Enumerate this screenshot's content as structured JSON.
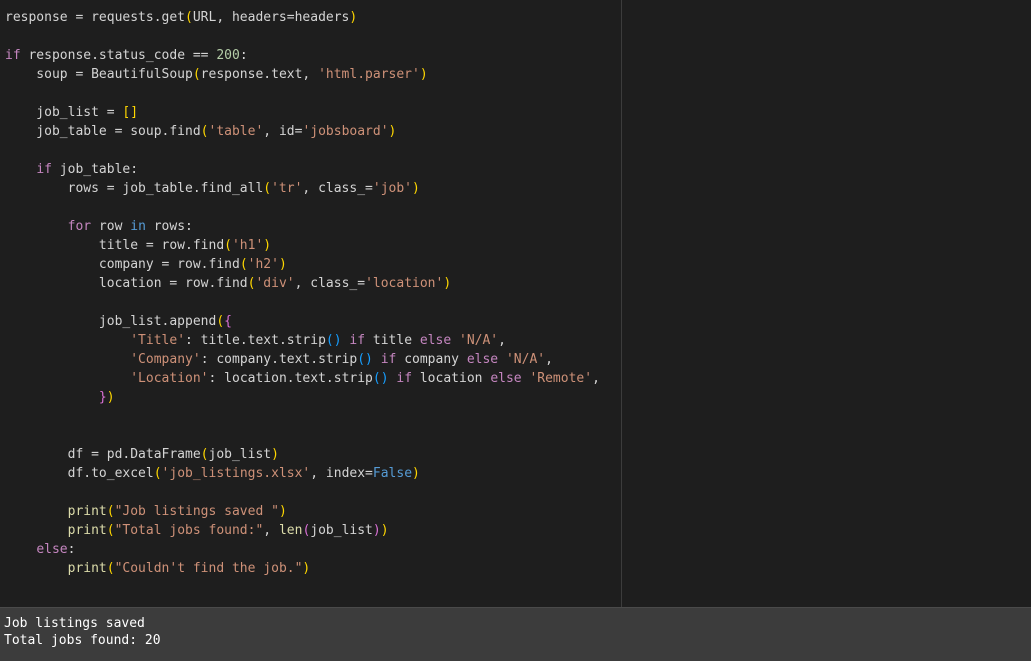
{
  "theme": {
    "default": "#d4d4d4",
    "keyword": "#569cd6",
    "control": "#c586c0",
    "string": "#ce9178",
    "paren": "#ffd700",
    "paren2": "#da70d6",
    "paren3": "#179fff",
    "function": "#dcdcaa",
    "number": "#b5cea8",
    "variable": "#9cdcfe"
  },
  "editor": {
    "lines": [
      [
        [
          "response = requests.get",
          "default"
        ],
        [
          "(",
          "paren"
        ],
        [
          "URL, headers=headers",
          "default"
        ],
        [
          ")",
          "paren"
        ]
      ],
      [],
      [
        [
          "if",
          "control"
        ],
        [
          " response.status_code == ",
          "default"
        ],
        [
          "200",
          "number"
        ],
        [
          ":",
          "default"
        ]
      ],
      [
        [
          "    soup = BeautifulSoup",
          "default"
        ],
        [
          "(",
          "paren"
        ],
        [
          "response.text, ",
          "default"
        ],
        [
          "'html.parser'",
          "string"
        ],
        [
          ")",
          "paren"
        ]
      ],
      [],
      [
        [
          "    job_list = ",
          "default"
        ],
        [
          "[]",
          "paren"
        ]
      ],
      [
        [
          "    job_table = soup.find",
          "default"
        ],
        [
          "(",
          "paren"
        ],
        [
          "'table'",
          "string"
        ],
        [
          ", id=",
          "default"
        ],
        [
          "'jobsboard'",
          "string"
        ],
        [
          ")",
          "paren"
        ]
      ],
      [],
      [
        [
          "    ",
          "default"
        ],
        [
          "if",
          "control"
        ],
        [
          " job_table:",
          "default"
        ]
      ],
      [
        [
          "        rows = job_table.find_all",
          "default"
        ],
        [
          "(",
          "paren"
        ],
        [
          "'tr'",
          "string"
        ],
        [
          ", class_=",
          "default"
        ],
        [
          "'job'",
          "string"
        ],
        [
          ")",
          "paren"
        ]
      ],
      [],
      [
        [
          "        ",
          "default"
        ],
        [
          "for",
          "control"
        ],
        [
          " row ",
          "default"
        ],
        [
          "in",
          "keyword"
        ],
        [
          " rows:",
          "default"
        ]
      ],
      [
        [
          "            title = row.find",
          "default"
        ],
        [
          "(",
          "paren"
        ],
        [
          "'h1'",
          "string"
        ],
        [
          ")",
          "paren"
        ]
      ],
      [
        [
          "            company = row.find",
          "default"
        ],
        [
          "(",
          "paren"
        ],
        [
          "'h2'",
          "string"
        ],
        [
          ")",
          "paren"
        ]
      ],
      [
        [
          "            location = row.find",
          "default"
        ],
        [
          "(",
          "paren"
        ],
        [
          "'div'",
          "string"
        ],
        [
          ", class_=",
          "default"
        ],
        [
          "'location'",
          "string"
        ],
        [
          ")",
          "paren"
        ]
      ],
      [],
      [
        [
          "            job_list.append",
          "default"
        ],
        [
          "(",
          "paren"
        ],
        [
          "{",
          "paren2"
        ]
      ],
      [
        [
          "                ",
          "default"
        ],
        [
          "'Title'",
          "string"
        ],
        [
          ": title.text.strip",
          "default"
        ],
        [
          "()",
          "paren3"
        ],
        [
          " ",
          "default"
        ],
        [
          "if",
          "control"
        ],
        [
          " title ",
          "default"
        ],
        [
          "else",
          "control"
        ],
        [
          " ",
          "default"
        ],
        [
          "'N/A'",
          "string"
        ],
        [
          ",",
          "default"
        ]
      ],
      [
        [
          "                ",
          "default"
        ],
        [
          "'Company'",
          "string"
        ],
        [
          ": company.text.strip",
          "default"
        ],
        [
          "()",
          "paren3"
        ],
        [
          " ",
          "default"
        ],
        [
          "if",
          "control"
        ],
        [
          " company ",
          "default"
        ],
        [
          "else",
          "control"
        ],
        [
          " ",
          "default"
        ],
        [
          "'N/A'",
          "string"
        ],
        [
          ",",
          "default"
        ]
      ],
      [
        [
          "                ",
          "default"
        ],
        [
          "'Location'",
          "string"
        ],
        [
          ": location.text.strip",
          "default"
        ],
        [
          "()",
          "paren3"
        ],
        [
          " ",
          "default"
        ],
        [
          "if",
          "control"
        ],
        [
          " location ",
          "default"
        ],
        [
          "else",
          "control"
        ],
        [
          " ",
          "default"
        ],
        [
          "'Remote'",
          "string"
        ],
        [
          ",",
          "default"
        ]
      ],
      [
        [
          "            ",
          "default"
        ],
        [
          "}",
          "paren2"
        ],
        [
          ")",
          "paren"
        ]
      ],
      [],
      [],
      [
        [
          "        df = pd.DataFrame",
          "default"
        ],
        [
          "(",
          "paren"
        ],
        [
          "job_list",
          "default"
        ],
        [
          ")",
          "paren"
        ]
      ],
      [
        [
          "        df.to_excel",
          "default"
        ],
        [
          "(",
          "paren"
        ],
        [
          "'job_listings.xlsx'",
          "string"
        ],
        [
          ", index=",
          "default"
        ],
        [
          "False",
          "keyword"
        ],
        [
          ")",
          "paren"
        ]
      ],
      [],
      [
        [
          "        print",
          "function"
        ],
        [
          "(",
          "paren"
        ],
        [
          "\"Job listings saved \"",
          "string"
        ],
        [
          ")",
          "paren"
        ]
      ],
      [
        [
          "        print",
          "function"
        ],
        [
          "(",
          "paren"
        ],
        [
          "\"Total jobs found:\"",
          "string"
        ],
        [
          ", ",
          "default"
        ],
        [
          "len",
          "function"
        ],
        [
          "(",
          "paren2"
        ],
        [
          "job_list",
          "default"
        ],
        [
          ")",
          "paren2"
        ],
        [
          ")",
          "paren"
        ]
      ],
      [
        [
          "    ",
          "default"
        ],
        [
          "else",
          "control"
        ],
        [
          ":",
          "default"
        ]
      ],
      [
        [
          "        print",
          "function"
        ],
        [
          "(",
          "paren"
        ],
        [
          "\"Couldn't find the job.\"",
          "string"
        ],
        [
          ")",
          "paren"
        ]
      ]
    ]
  },
  "output": {
    "line1": "Job listings saved",
    "line2": "Total jobs found: 20"
  }
}
